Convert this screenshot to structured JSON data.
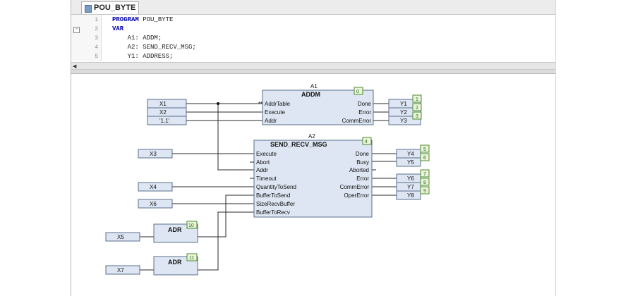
{
  "editor_tab": {
    "title": "POU_BYTE"
  },
  "code_lines": [
    {
      "num": "1",
      "kw": "PROGRAM",
      "rest": " POU_BYTE"
    },
    {
      "num": "2",
      "kw": "VAR",
      "rest": ""
    },
    {
      "num": "3",
      "kw": "",
      "rest": "    A1: ADDM;"
    },
    {
      "num": "4",
      "kw": "",
      "rest": "    A2: SEND_RECV_MSG;"
    },
    {
      "num": "5",
      "kw": "",
      "rest": "    Y1: ADDRESS;"
    }
  ],
  "fold_marker": "-",
  "blocks": {
    "addm": {
      "instance": "A1",
      "type": "ADDM",
      "order": "0",
      "inputs": [
        "AddrTable",
        "Execute",
        "Addr"
      ],
      "outputs": [
        "Done",
        "Error",
        "CommError"
      ]
    },
    "send_recv": {
      "instance": "A2",
      "type": "SEND_RECV_MSG",
      "order": "4",
      "inputs": [
        "Execute",
        "Abort",
        "Addr",
        "Timeout",
        "QuantityToSend",
        "BufferToSend",
        "SizeRecvBuffer",
        "BufferToRecv"
      ],
      "outputs": [
        "Done",
        "Busy",
        "Aborted",
        "Error",
        "CommError",
        "OperError"
      ]
    },
    "adr1": {
      "type": "ADR",
      "order": "10"
    },
    "adr2": {
      "type": "ADR",
      "order": "11"
    }
  },
  "addm_input_vars": [
    "X1",
    "X2",
    "'1.1'"
  ],
  "addm_output_vars": [
    {
      "name": "Y1",
      "order": "1"
    },
    {
      "name": "Y2",
      "order": "2"
    },
    {
      "name": "Y3",
      "order": "3"
    }
  ],
  "send_input_vars": [
    "X3",
    "X4",
    "X6"
  ],
  "send_output_vars": [
    {
      "name": "Y4",
      "order": "5"
    },
    {
      "name": "Y5",
      "order": "6"
    },
    {
      "name": "Y6",
      "order": "7"
    },
    {
      "name": "Y7",
      "order": "8"
    },
    {
      "name": "Y8",
      "order": "9"
    }
  ],
  "adr_input_vars": [
    "X5",
    "X7"
  ],
  "colors": {
    "block_fill": "#dde6f2",
    "block_border": "#5a6f8c",
    "badge_fill": "#eaf4dc",
    "badge_border": "#4c8a2c",
    "keyword": "#0000b0"
  }
}
